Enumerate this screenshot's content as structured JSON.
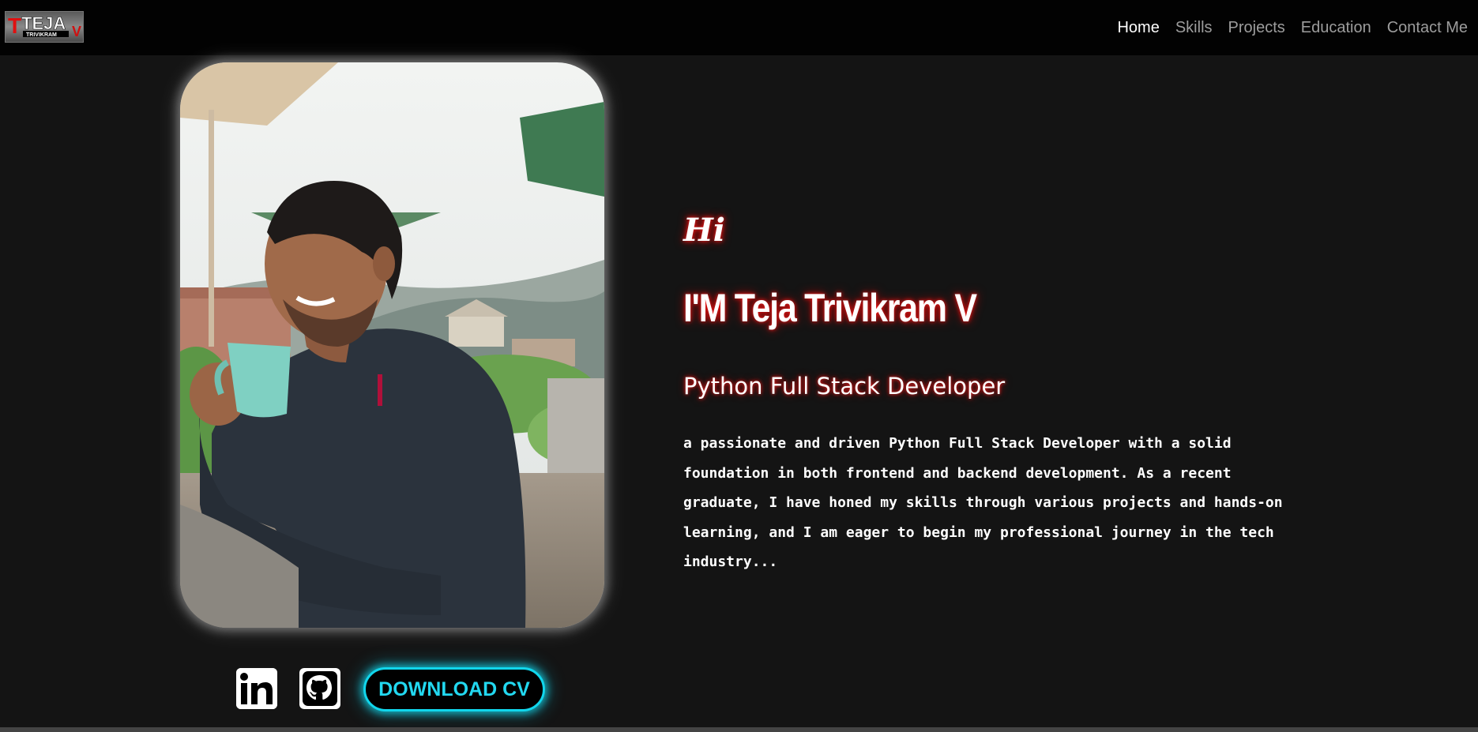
{
  "navbar": {
    "logo": {
      "big_text": "TEJA",
      "initial": "T",
      "end_letter": "V",
      "sub_text": "TRIVIKRAM"
    },
    "links": [
      {
        "label": "Home",
        "active": true
      },
      {
        "label": "Skills",
        "active": false
      },
      {
        "label": "Projects",
        "active": false
      },
      {
        "label": "Education",
        "active": false
      },
      {
        "label": "Contact Me",
        "active": false
      }
    ]
  },
  "hero": {
    "greeting": "Hi",
    "name": "I'M Teja Trivikram V",
    "role": "Python Full Stack Developer",
    "bio": "a passionate and driven Python Full Stack Developer with a solid foundation in both frontend and backend development. As a recent graduate, I have honed my skills through various projects and hands-on learning, and I am eager to begin my professional journey in the tech industry...",
    "photo_icon": "profile-photo"
  },
  "actions": {
    "linkedin_icon": "linkedin-icon",
    "github_icon": "github-icon",
    "download_cv_label": "DOWNLOAD CV"
  },
  "colors": {
    "background": "#141414",
    "navbar": "#020202",
    "accent_cyan": "#11d6ec",
    "glow_red": "#ff1a1a",
    "nav_inactive": "#9d9d9d"
  }
}
